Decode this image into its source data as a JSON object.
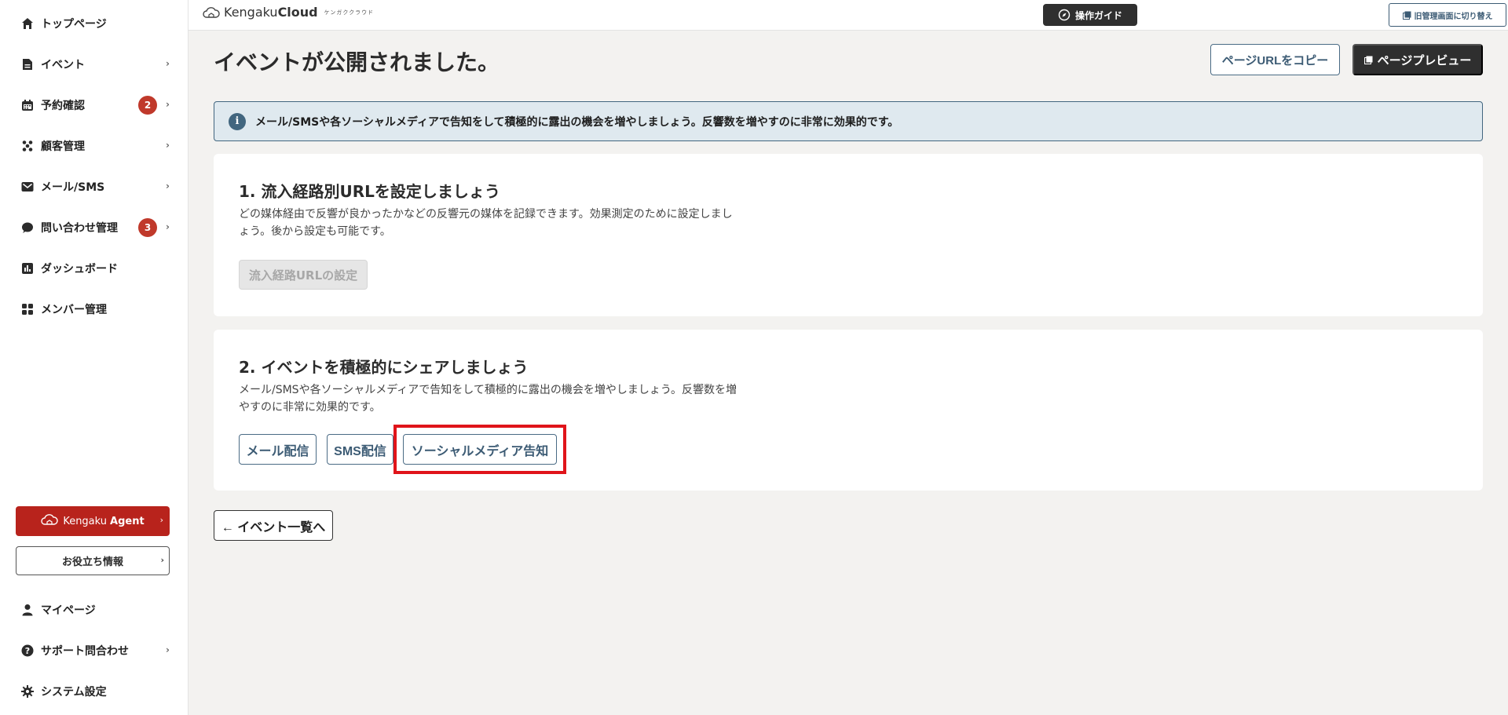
{
  "sidebar": {
    "items": [
      {
        "label": "トップページ",
        "icon": "home-icon"
      },
      {
        "label": "イベント",
        "icon": "document-icon"
      },
      {
        "label": "予約確認",
        "icon": "calendar-icon",
        "badge": "2"
      },
      {
        "label": "顧客管理",
        "icon": "customers-icon"
      },
      {
        "label": "メール/SMS",
        "icon": "mail-icon"
      },
      {
        "label": "問い合わせ管理",
        "icon": "chat-icon",
        "badge": "3"
      },
      {
        "label": "ダッシュボード",
        "icon": "chart-icon"
      },
      {
        "label": "メンバー管理",
        "icon": "grid-icon"
      }
    ],
    "agent_button": {
      "brand1": "Kengaku",
      "brand2": "Agent"
    },
    "help_button": "お役立ち情報",
    "bottom_items": [
      {
        "label": "マイページ",
        "icon": "user-icon"
      },
      {
        "label": "サポート問合わせ",
        "icon": "help-icon"
      },
      {
        "label": "システム設定",
        "icon": "gear-icon"
      }
    ]
  },
  "topbar": {
    "logo_light": "Kengaku",
    "logo_bold": "Cloud",
    "logo_kana": "ケンガククラウド",
    "guide_button": "操作ガイド",
    "old_admin_button": "旧管理画面に切り替え"
  },
  "main": {
    "title": "イベントが公開されました。",
    "copy_url_button": "ページURLをコピー",
    "preview_button": "ページプレビュー",
    "info_banner": "メール/SMSや各ソーシャルメディアで告知をして積極的に露出の機会を増やしましょう。反響数を増やすのに非常に効果的です。",
    "section1": {
      "title": "1. 流入経路別URLを設定しましょう",
      "description": "どの媒体経由で反響が良かったかなどの反響元の媒体を記録できます。効果測定のために設定しましょう。後から設定も可能です。",
      "button": "流入経路URLの設定"
    },
    "section2": {
      "title": "2. イベントを積極的にシェアしましょう",
      "description": "メール/SMSや各ソーシャルメディアで告知をして積極的に露出の機会を増やしましょう。反響数を増やすのに非常に効果的です。",
      "mail_button": "メール配信",
      "sms_button": "SMS配信",
      "social_button": "ソーシャルメディア告知"
    },
    "back_button": "← イベント一覧へ"
  },
  "colors": {
    "accent": "#3c5b74",
    "badge": "#c0392b",
    "agent": "#b8231c",
    "highlight": "#e0141a"
  }
}
